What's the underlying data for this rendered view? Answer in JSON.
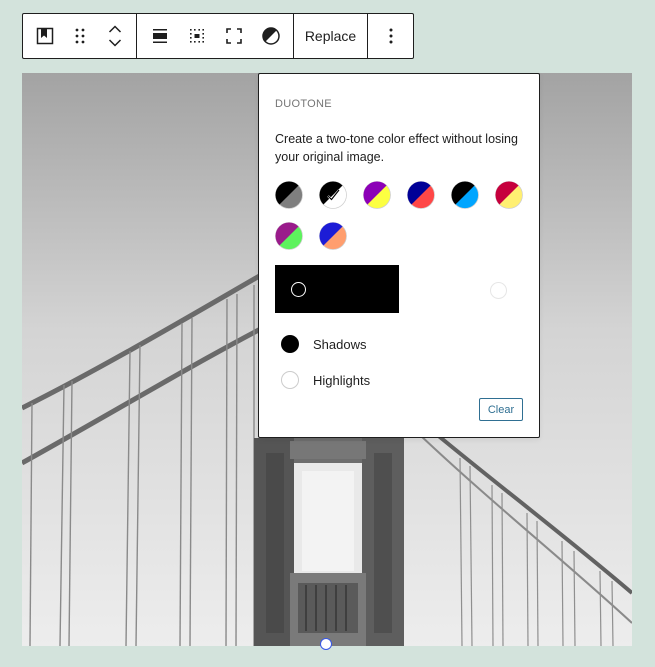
{
  "toolbar": {
    "replace_label": "Replace",
    "icons": [
      "bookmark-icon",
      "drag-handle-icon",
      "move-up-icon",
      "move-down-icon",
      "align-icon",
      "width-icon",
      "fullscreen-icon",
      "duotone-icon",
      "more-options-icon"
    ]
  },
  "popover": {
    "title": "DUOTONE",
    "description": "Create a two-tone color effect without losing your original image.",
    "swatches": [
      {
        "shadow": "#000000",
        "highlight": "#7f7f7f"
      },
      {
        "shadow": "#000000",
        "highlight": "#ffffff",
        "selected": true
      },
      {
        "shadow": "#8c00b7",
        "highlight": "#fcff41"
      },
      {
        "shadow": "#000097",
        "highlight": "#ff4747"
      },
      {
        "shadow": "#000000",
        "highlight": "#00a5ff"
      },
      {
        "shadow": "#c6003d",
        "highlight": "#ffef72"
      },
      {
        "shadow": "#9a1b8b",
        "highlight": "#5df25d"
      },
      {
        "shadow": "#1c1cd6",
        "highlight": "#ff9e6e"
      }
    ],
    "shadows_label": "Shadows",
    "highlights_label": "Highlights",
    "clear_label": "Clear"
  },
  "colors": {
    "background": "#d3e3dc",
    "accent": "#2f6f92",
    "border": "#1e1e1e"
  }
}
